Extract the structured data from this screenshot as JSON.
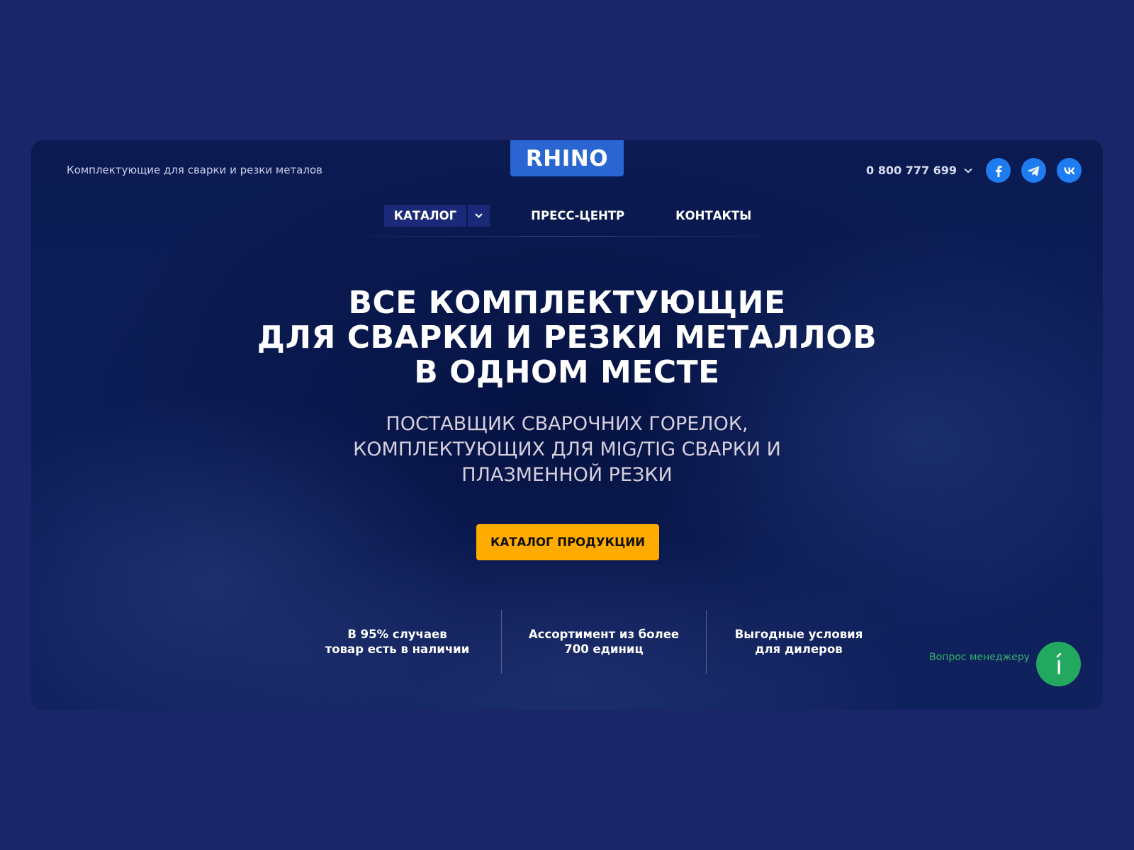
{
  "header": {
    "tagline": "Комплектующие для сварки и резки металов",
    "logo_text": "RHINO",
    "phone": "0 800 777 699"
  },
  "socials": [
    {
      "name": "facebook",
      "icon": "facebook-icon"
    },
    {
      "name": "telegram",
      "icon": "telegram-icon"
    },
    {
      "name": "vk",
      "icon": "vk-icon"
    }
  ],
  "nav": {
    "items": [
      {
        "label": "КАТАЛОГ"
      },
      {
        "label": "ПРЕСС-ЦЕНТР"
      },
      {
        "label": "КОНТАКТЫ"
      }
    ]
  },
  "hero": {
    "headline": [
      "ВСЕ КОМПЛЕКТУЮЩИЕ",
      "ДЛЯ СВАРКИ И РЕЗКИ МЕТАЛЛОВ",
      "В ОДНОМ МЕСТЕ"
    ],
    "subline": [
      "ПОСТАВЩИК СВАРОЧНИХ ГОРЕЛОК,",
      "КОМПЛЕКТУЮЩИХ ДЛЯ MIG/TIG СВАРКИ И",
      "ПЛАЗМЕННОЙ РЕЗКИ"
    ],
    "cta_label": "КАТАЛОГ ПРОДУКЦИИ"
  },
  "features": [
    {
      "line1": "В 95% случаев",
      "line2": "товар есть в наличии"
    },
    {
      "line1": "Ассортимент из более",
      "line2": "700 единиц"
    },
    {
      "line1": "Выгодные условия",
      "line2": "для дилеров"
    }
  ],
  "manager": {
    "label": "Вопрос менеджеру"
  },
  "colors": {
    "page_bg": "#1b2569",
    "logo_bg": "#2a66d1",
    "cta_bg": "#ffab00",
    "social_bg": "#1e7cf0",
    "manager_green": "#23a95f"
  }
}
